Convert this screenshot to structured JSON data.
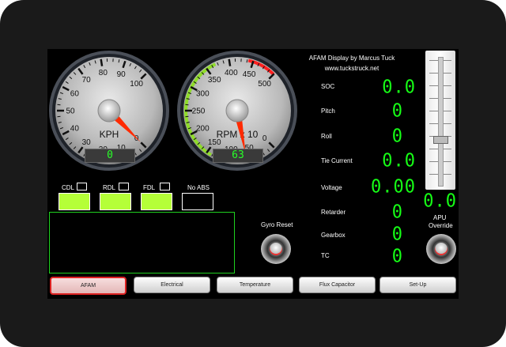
{
  "header": {
    "title": "AFAM Display by Marcus Tuck",
    "url": "www.tuckstruck.net"
  },
  "speed_gauge": {
    "unit": "KPH",
    "ticks": [
      "0",
      "10",
      "20",
      "30",
      "40",
      "50",
      "60",
      "70",
      "80",
      "90",
      "100"
    ],
    "value": 0,
    "readout": "0",
    "min": 0,
    "max": 100
  },
  "rpm_gauge": {
    "unit": "RPM x 10",
    "ticks": [
      "0",
      "50",
      "100",
      "150",
      "200",
      "250",
      "300",
      "350",
      "400",
      "450",
      "500"
    ],
    "value": 63,
    "readout": "63",
    "min": 0,
    "max": 500
  },
  "indicators": [
    {
      "label": "CDL",
      "on": true
    },
    {
      "label": "RDL",
      "on": true
    },
    {
      "label": "FDL",
      "on": true
    },
    {
      "label": "No ABS",
      "on": false
    }
  ],
  "readings": [
    {
      "label": "SOC",
      "value": "0.0"
    },
    {
      "label": "Pitch",
      "value": "0"
    },
    {
      "label": "Roll",
      "value": "0"
    },
    {
      "label": "Tie Current",
      "value": "0.0"
    },
    {
      "label": "Voltage",
      "value": "0.00"
    },
    {
      "label": "Retarder",
      "value": "0"
    },
    {
      "label": "Gearbox",
      "value": "0"
    },
    {
      "label": "TC",
      "value": "0"
    }
  ],
  "slider": {
    "value": "0.0"
  },
  "buttons": {
    "gyro_reset": "Gyro Reset",
    "apu_override_1": "APU",
    "apu_override_2": "Override"
  },
  "tabs": [
    {
      "label": "AFAM",
      "active": true
    },
    {
      "label": "Electrical",
      "active": false
    },
    {
      "label": "Temperature",
      "active": false
    },
    {
      "label": "Flux Capacitor",
      "active": false
    },
    {
      "label": "Set-Up",
      "active": false
    }
  ],
  "colors": {
    "led_green": "#16ff16",
    "indicator_on": "#b5ff38",
    "needle": "#ff2a00",
    "tab_active_border": "#dd2222"
  }
}
